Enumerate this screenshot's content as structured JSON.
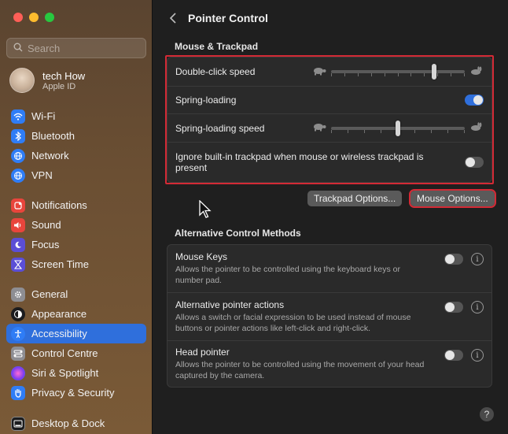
{
  "sidebar": {
    "search": {
      "placeholder": "Search"
    },
    "user": {
      "name": "tech How",
      "subtitle": "Apple ID"
    },
    "groups": [
      [
        {
          "label": "Wi-Fi",
          "icon": "wifi-icon",
          "color": "#2f7df6"
        },
        {
          "label": "Bluetooth",
          "icon": "bluetooth-icon",
          "color": "#2f7df6"
        },
        {
          "label": "Network",
          "icon": "network-icon",
          "color": "#2f7df6"
        },
        {
          "label": "VPN",
          "icon": "vpn-icon",
          "color": "#2f7df6"
        }
      ],
      [
        {
          "label": "Notifications",
          "icon": "notifications-icon",
          "color": "#e8453c"
        },
        {
          "label": "Sound",
          "icon": "sound-icon",
          "color": "#e8453c"
        },
        {
          "label": "Focus",
          "icon": "focus-icon",
          "color": "#5b4ed6"
        },
        {
          "label": "Screen Time",
          "icon": "screen-time-icon",
          "color": "#5b4ed6"
        }
      ],
      [
        {
          "label": "General",
          "icon": "gear-icon",
          "color": "#8e8e93"
        },
        {
          "label": "Appearance",
          "icon": "appearance-icon",
          "color": "#1c1c1e"
        },
        {
          "label": "Accessibility",
          "icon": "accessibility-icon",
          "color": "#2f7df6",
          "active": true
        },
        {
          "label": "Control Centre",
          "icon": "control-centre-icon",
          "color": "#8e8e93"
        },
        {
          "label": "Siri & Spotlight",
          "icon": "siri-icon",
          "color": "#b84fd8"
        },
        {
          "label": "Privacy & Security",
          "icon": "hand-icon",
          "color": "#2f7df6"
        }
      ],
      [
        {
          "label": "Desktop & Dock",
          "icon": "dock-icon",
          "color": "#1c1c1e"
        }
      ]
    ]
  },
  "header": {
    "title": "Pointer Control"
  },
  "mouse_trackpad": {
    "title": "Mouse & Trackpad",
    "double_click": {
      "label": "Double-click speed",
      "value": 0.78,
      "ticks": 11
    },
    "spring_loading": {
      "label": "Spring-loading",
      "on": true
    },
    "spring_speed": {
      "label": "Spring-loading speed",
      "value": 0.5,
      "ticks": 9
    },
    "ignore_trackpad": {
      "label": "Ignore built-in trackpad when mouse or wireless trackpad is present",
      "on": false
    }
  },
  "buttons": {
    "trackpad_options": "Trackpad Options...",
    "mouse_options": "Mouse Options..."
  },
  "alternative": {
    "title": "Alternative Control Methods",
    "items": [
      {
        "label": "Mouse Keys",
        "desc": "Allows the pointer to be controlled using the keyboard keys or number pad.",
        "on": false
      },
      {
        "label": "Alternative pointer actions",
        "desc": "Allows a switch or facial expression to be used instead of mouse buttons or pointer actions like left-click and right-click.",
        "on": false
      },
      {
        "label": "Head pointer",
        "desc": "Allows the pointer to be controlled using the movement of your head captured by the camera.",
        "on": false
      }
    ]
  },
  "colors": {
    "accent": "#2f6fdc",
    "highlight": "#d32a35"
  }
}
